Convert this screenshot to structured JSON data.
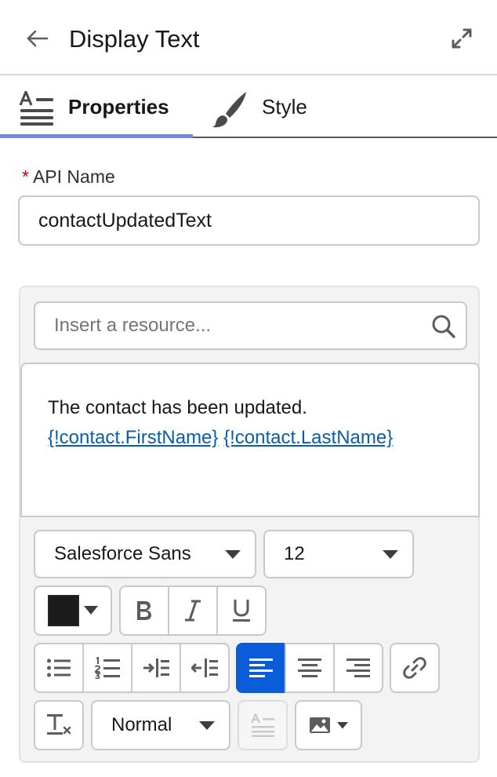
{
  "header": {
    "title": "Display Text",
    "back_icon": "arrow-left-icon",
    "expand_icon": "expand-icon"
  },
  "tabs": [
    {
      "label": "Properties",
      "icon": "text-format-icon",
      "active": true
    },
    {
      "label": "Style",
      "icon": "paintbrush-icon",
      "active": false
    }
  ],
  "api_name": {
    "required_marker": "*",
    "label": "API Name",
    "value": "contactUpdatedText"
  },
  "resource_search": {
    "placeholder": "Insert a resource...",
    "icon": "search-icon"
  },
  "editor": {
    "line1": "The contact has been updated.",
    "merge_fields": [
      "{!contact.FirstName}",
      "{!contact.LastName}"
    ]
  },
  "toolbar": {
    "font_family": "Salesforce Sans",
    "font_size": "12",
    "text_color": "#1b1b1b",
    "paragraph_format": "Normal",
    "active_alignment": "left",
    "accent_color": "#0b5cd8"
  }
}
